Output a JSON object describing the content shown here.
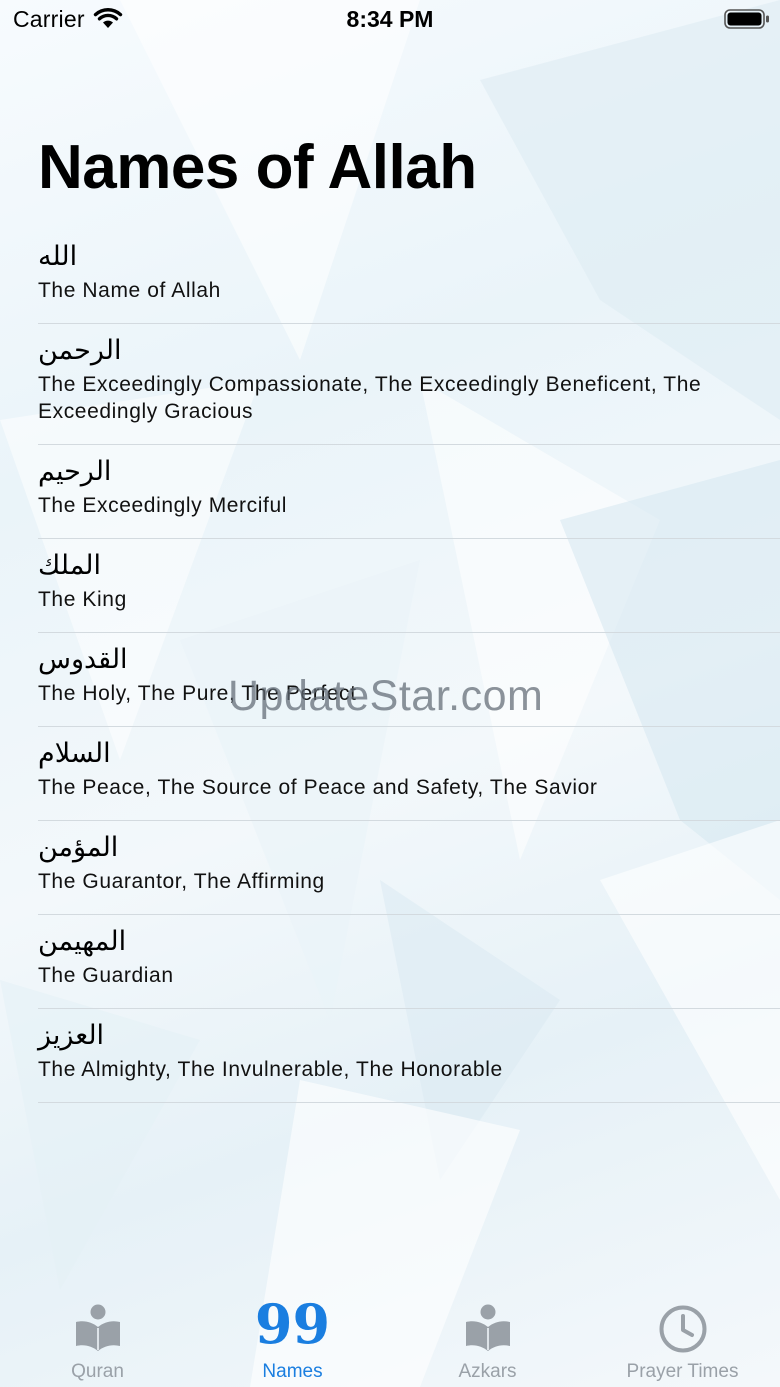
{
  "status_bar": {
    "carrier": "Carrier",
    "time": "8:34 PM"
  },
  "page": {
    "title": "Names of Allah"
  },
  "names": [
    {
      "arabic": "الله",
      "english": "The Name of Allah"
    },
    {
      "arabic": "الرحمن",
      "english": "The Exceedingly Compassionate, The Exceedingly Beneficent, The Exceedingly Gracious"
    },
    {
      "arabic": "الرحيم",
      "english": "The Exceedingly Merciful"
    },
    {
      "arabic": "الملك",
      "english": "The King"
    },
    {
      "arabic": "القدوس",
      "english": "The Holy, The Pure, The Perfect"
    },
    {
      "arabic": "السلام",
      "english": "The Peace, The Source of Peace and Safety, The Savior"
    },
    {
      "arabic": "المؤمن",
      "english": "The Guarantor, The Affirming"
    },
    {
      "arabic": "المهيمن",
      "english": "The Guardian"
    },
    {
      "arabic": "العزيز",
      "english": "The Almighty, The Invulnerable, The Honorable"
    }
  ],
  "watermark": "UpdateStar.com",
  "tab_bar": {
    "tabs": [
      {
        "label": "Quran",
        "icon": "reading-book-icon",
        "active": false
      },
      {
        "label": "Names",
        "icon_text": "99",
        "active": true
      },
      {
        "label": "Azkars",
        "icon": "reading-book-icon",
        "active": false
      },
      {
        "label": "Prayer Times",
        "icon": "clock-icon",
        "active": false
      }
    ]
  },
  "colors": {
    "accent": "#1a7ee0",
    "inactive_tab": "#9aa1a8",
    "separator": "#d3dadf"
  }
}
